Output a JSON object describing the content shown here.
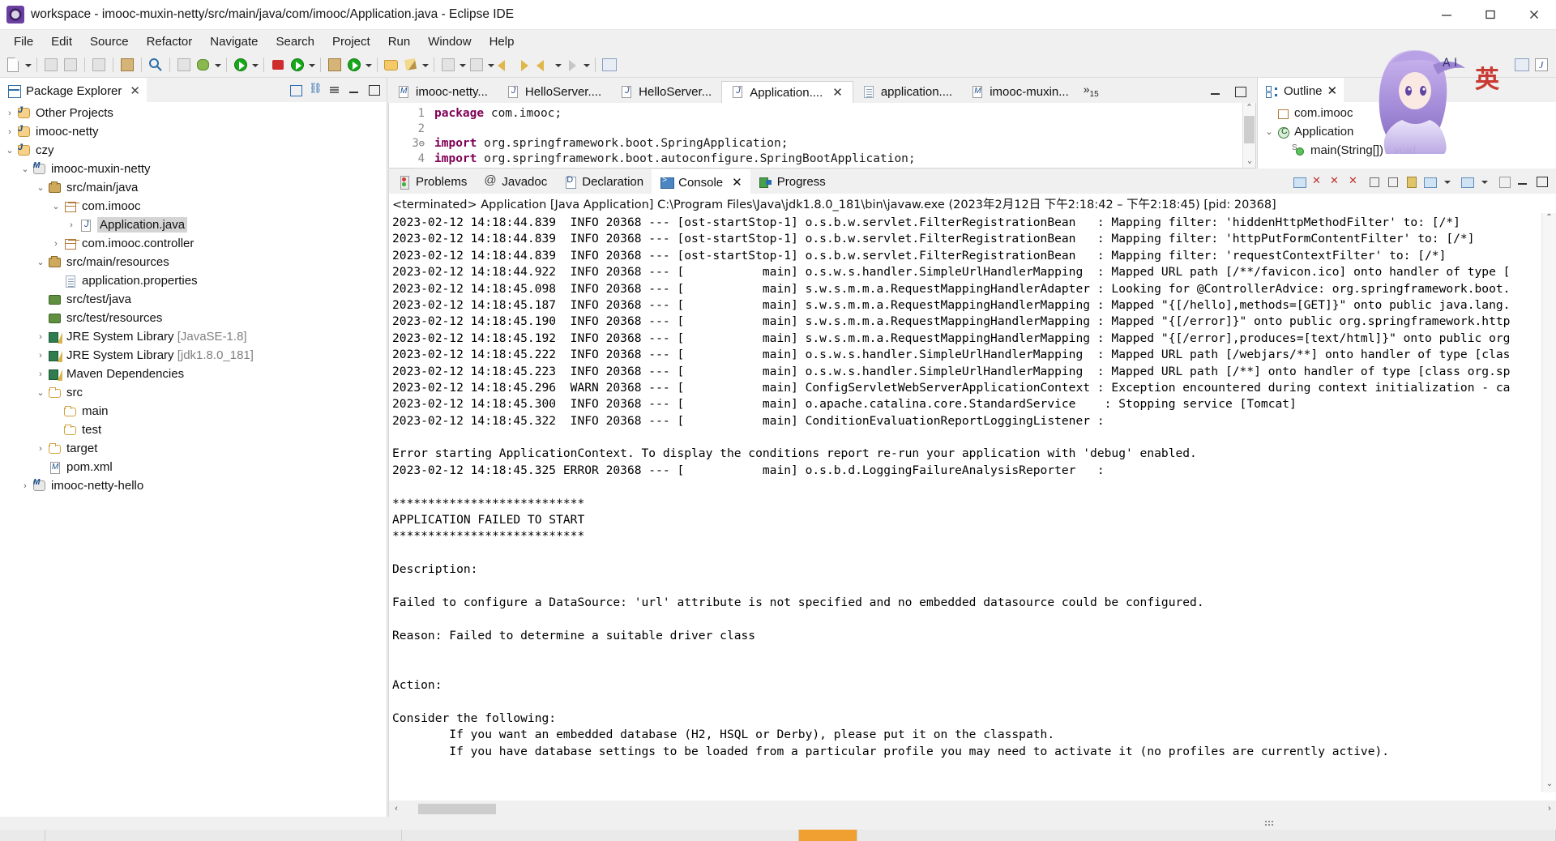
{
  "window": {
    "title": "workspace - imooc-muxin-netty/src/main/java/com/imooc/Application.java - Eclipse IDE",
    "app_icon": "eclipse-icon",
    "minimize": "minimize-button",
    "maximize": "maximize-button",
    "close": "close-button"
  },
  "menubar": {
    "items": [
      "File",
      "Edit",
      "Source",
      "Refactor",
      "Navigate",
      "Search",
      "Project",
      "Run",
      "Window",
      "Help"
    ]
  },
  "toolbar": {
    "groups": [
      [
        "new-icon",
        "caret-down-icon"
      ],
      [
        "save-icon",
        "save-all-icon"
      ],
      [
        "print-icon"
      ],
      [
        "build-icon"
      ],
      [
        "debug-icon",
        "caret-down-icon",
        "run-icon",
        "caret-down-icon",
        "coverage-icon",
        "caret-down-icon"
      ],
      [
        "external-tools-icon",
        "caret-down-icon"
      ],
      [
        "new-java-project-icon",
        "new-package-icon",
        "new-class-icon",
        "caret-down-icon"
      ],
      [
        "search-icon"
      ],
      [
        "open-task-icon",
        "caret-down-icon"
      ],
      [
        "next-annotation-icon",
        "caret-down-icon",
        "previous-annotation-icon",
        "caret-down-icon"
      ],
      [
        "back-icon",
        "forward-icon",
        "back-alt-icon",
        "caret-down-icon",
        "forward-alt-icon",
        "caret-down-icon"
      ],
      [
        "pin-editor-icon"
      ]
    ],
    "right": [
      "open-perspective-icon",
      "java-perspective-icon"
    ]
  },
  "package_explorer": {
    "tab_label": "Package Explorer",
    "tab_icon": "package-explorer-icon",
    "close_icon": "✕",
    "tools": [
      "collapse-all-icon",
      "link-with-editor-icon",
      "view-menu-icon",
      "minimize-icon",
      "maximize-icon"
    ],
    "tree": [
      {
        "label": "Other Projects",
        "indent": 0,
        "twist": "›",
        "icon": "java-project-icon",
        "selected": false
      },
      {
        "label": "imooc-netty",
        "indent": 0,
        "twist": "›",
        "icon": "folder-project-icon",
        "selected": false
      },
      {
        "label": "czy",
        "indent": 0,
        "twist": "⌄",
        "icon": "java-project-icon",
        "selected": false
      },
      {
        "label": "imooc-muxin-netty",
        "indent": 1,
        "twist": "⌄",
        "icon": "maven-project-icon",
        "selected": false
      },
      {
        "label": "src/main/java",
        "indent": 2,
        "twist": "⌄",
        "icon": "source-folder-icon",
        "selected": false
      },
      {
        "label": "com.imooc",
        "indent": 3,
        "twist": "⌄",
        "icon": "package-icon",
        "selected": false
      },
      {
        "label": "Application.java",
        "indent": 4,
        "twist": "›",
        "icon": "java-file-icon",
        "selected": true
      },
      {
        "label": "com.imooc.controller",
        "indent": 3,
        "twist": "›",
        "icon": "package-icon",
        "selected": false
      },
      {
        "label": "src/main/resources",
        "indent": 2,
        "twist": "⌄",
        "icon": "source-folder-icon",
        "selected": false
      },
      {
        "label": "application.properties",
        "indent": 3,
        "twist": "",
        "icon": "properties-file-icon",
        "selected": false
      },
      {
        "label": "src/test/java",
        "indent": 2,
        "twist": "",
        "icon": "source-folder-green-icon",
        "selected": false
      },
      {
        "label": "src/test/resources",
        "indent": 2,
        "twist": "",
        "icon": "source-folder-green-icon",
        "selected": false
      },
      {
        "label": "JRE System Library ",
        "dim": "[JavaSE-1.8]",
        "indent": 2,
        "twist": "›",
        "icon": "library-icon",
        "selected": false
      },
      {
        "label": "JRE System Library ",
        "dim": "[jdk1.8.0_181]",
        "indent": 2,
        "twist": "›",
        "icon": "library-icon",
        "selected": false
      },
      {
        "label": "Maven Dependencies",
        "indent": 2,
        "twist": "›",
        "icon": "library-icon",
        "selected": false
      },
      {
        "label": "src",
        "indent": 2,
        "twist": "⌄",
        "icon": "folder-icon",
        "selected": false
      },
      {
        "label": "main",
        "indent": 3,
        "twist": "",
        "icon": "folder-icon",
        "selected": false
      },
      {
        "label": "test",
        "indent": 3,
        "twist": "",
        "icon": "folder-icon",
        "selected": false
      },
      {
        "label": "target",
        "indent": 2,
        "twist": "›",
        "icon": "folder-icon",
        "selected": false
      },
      {
        "label": "pom.xml",
        "indent": 2,
        "twist": "",
        "icon": "maven-xml-icon",
        "selected": false
      },
      {
        "label": "imooc-netty-hello",
        "indent": 1,
        "twist": "›",
        "icon": "maven-project-icon",
        "selected": false
      }
    ]
  },
  "editor": {
    "tabs": [
      {
        "label": "imooc-netty...",
        "icon": "maven-xml-icon",
        "active": false,
        "closable": false
      },
      {
        "label": "HelloServer....",
        "icon": "java-file-icon",
        "active": false,
        "closable": false
      },
      {
        "label": "HelloServer...",
        "icon": "java-file-icon",
        "active": false,
        "closable": false
      },
      {
        "label": "Application....",
        "icon": "java-file-icon",
        "active": true,
        "closable": true
      },
      {
        "label": "application....",
        "icon": "properties-file-icon",
        "active": false,
        "closable": false
      },
      {
        "label": "imooc-muxin...",
        "icon": "maven-xml-icon",
        "active": false,
        "closable": false
      }
    ],
    "overflow_label": "»",
    "overflow_count": "15",
    "minimize": "minimize-icon",
    "maximize": "maximize-icon",
    "lines": [
      {
        "num": "1",
        "fold": "",
        "text": "package com.imooc;",
        "kw": "package"
      },
      {
        "num": "2",
        "fold": "",
        "text": "",
        "kw": ""
      },
      {
        "num": "3",
        "fold": "⊖",
        "text": "import org.springframework.boot.SpringApplication;",
        "kw": "import"
      },
      {
        "num": "4",
        "fold": "",
        "text": "import org.springframework.boot.autoconfigure.SpringBootApplication;",
        "kw": "import"
      }
    ],
    "scroll_up": "⌃",
    "scroll_down": "⌄"
  },
  "outline": {
    "tab_label": "Outline",
    "tab_icon": "outline-icon",
    "close_icon": "✕",
    "items": [
      {
        "label": "com.imooc",
        "indent": 0,
        "twist": "",
        "icon": "package-declaration-icon"
      },
      {
        "label": "Application",
        "indent": 0,
        "twist": "⌄",
        "icon": "class-icon"
      },
      {
        "label": "main(String[]) : void",
        "indent": 1,
        "twist": "",
        "icon": "method-icon",
        "sup": "S"
      }
    ]
  },
  "console": {
    "tabs": [
      {
        "label": "Problems",
        "icon": "problems-icon",
        "active": false
      },
      {
        "label": "Javadoc",
        "icon": "javadoc-icon",
        "active": false
      },
      {
        "label": "Declaration",
        "icon": "declaration-icon",
        "active": false
      },
      {
        "label": "Console",
        "icon": "console-icon",
        "active": true,
        "closable": true
      },
      {
        "label": "Progress",
        "icon": "progress-icon",
        "active": false
      }
    ],
    "tools": [
      "clear-console-icon",
      "terminate-icon",
      "remove-launch-icon",
      "remove-all-terminated-icon",
      "scroll-lock-icon",
      "word-wrap-icon",
      "pin-console-icon",
      "display-selected-console-icon",
      "caret-down-icon",
      "open-console-icon",
      "caret-down-icon",
      "view-menu-icon",
      "minimize-icon",
      "maximize-icon"
    ],
    "header": "<terminated> Application [Java Application] C:\\Program Files\\Java\\jdk1.8.0_181\\bin\\javaw.exe  (2023年2月12日 下午2:18:42 – 下午2:18:45) [pid: 20368]",
    "lines": [
      "2023-02-12 14:18:44.839  INFO 20368 --- [ost-startStop-1] o.s.b.w.servlet.FilterRegistrationBean   : Mapping filter: 'hiddenHttpMethodFilter' to: [/*]",
      "2023-02-12 14:18:44.839  INFO 20368 --- [ost-startStop-1] o.s.b.w.servlet.FilterRegistrationBean   : Mapping filter: 'httpPutFormContentFilter' to: [/*]",
      "2023-02-12 14:18:44.839  INFO 20368 --- [ost-startStop-1] o.s.b.w.servlet.FilterRegistrationBean   : Mapping filter: 'requestContextFilter' to: [/*]",
      "2023-02-12 14:18:44.922  INFO 20368 --- [           main] o.s.w.s.handler.SimpleUrlHandlerMapping  : Mapped URL path [/**/favicon.ico] onto handler of type [",
      "2023-02-12 14:18:45.098  INFO 20368 --- [           main] s.w.s.m.m.a.RequestMappingHandlerAdapter : Looking for @ControllerAdvice: org.springframework.boot.",
      "2023-02-12 14:18:45.187  INFO 20368 --- [           main] s.w.s.m.m.a.RequestMappingHandlerMapping : Mapped \"{[/hello],methods=[GET]}\" onto public java.lang.",
      "2023-02-12 14:18:45.190  INFO 20368 --- [           main] s.w.s.m.m.a.RequestMappingHandlerMapping : Mapped \"{[/error]}\" onto public org.springframework.http",
      "2023-02-12 14:18:45.192  INFO 20368 --- [           main] s.w.s.m.m.a.RequestMappingHandlerMapping : Mapped \"{[/error],produces=[text/html]}\" onto public org",
      "2023-02-12 14:18:45.222  INFO 20368 --- [           main] o.s.w.s.handler.SimpleUrlHandlerMapping  : Mapped URL path [/webjars/**] onto handler of type [clas",
      "2023-02-12 14:18:45.223  INFO 20368 --- [           main] o.s.w.s.handler.SimpleUrlHandlerMapping  : Mapped URL path [/**] onto handler of type [class org.sp",
      "2023-02-12 14:18:45.296  WARN 20368 --- [           main] ConfigServletWebServerApplicationContext : Exception encountered during context initialization - ca",
      "2023-02-12 14:18:45.300  INFO 20368 --- [           main] o.apache.catalina.core.StandardService    : Stopping service [Tomcat]",
      "2023-02-12 14:18:45.322  INFO 20368 --- [           main] ConditionEvaluationReportLoggingListener :",
      "",
      "Error starting ApplicationContext. To display the conditions report re-run your application with 'debug' enabled.",
      "2023-02-12 14:18:45.325 ERROR 20368 --- [           main] o.s.b.d.LoggingFailureAnalysisReporter   :",
      "",
      "***************************",
      "APPLICATION FAILED TO START",
      "***************************",
      "",
      "Description:",
      "",
      "Failed to configure a DataSource: 'url' attribute is not specified and no embedded datasource could be configured.",
      "",
      "Reason: Failed to determine a suitable driver class",
      "",
      "",
      "Action:",
      "",
      "Consider the following:",
      "        If you want an embedded database (H2, HSQL or Derby), please put it on the classpath.",
      "        If you have database settings to be loaded from a particular profile you may need to activate it (no profiles are currently active)."
    ],
    "scroll_up": "⌃",
    "scroll_down": "⌄",
    "hscroll_left": "‹",
    "hscroll_right": "›"
  },
  "colors": {
    "keyword": "#7f0055",
    "selection": "#d4d4d4",
    "accent": "#2f6ea5",
    "taskbar_active": "#f0a030"
  }
}
